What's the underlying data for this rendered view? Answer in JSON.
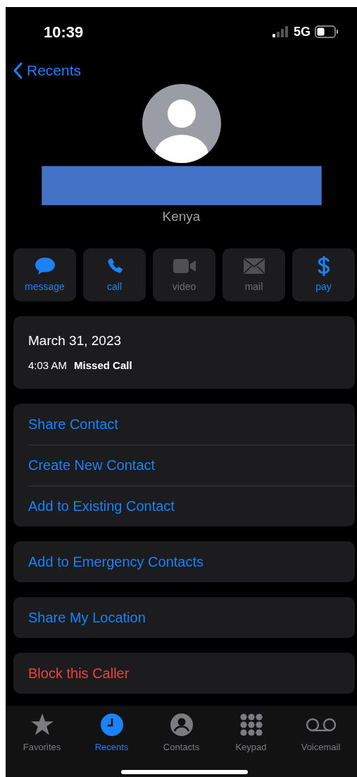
{
  "status_bar": {
    "time": "10:39",
    "network": "5G"
  },
  "nav": {
    "back_label": "Recents"
  },
  "contact": {
    "name_redacted": true,
    "location": "Kenya"
  },
  "actions": [
    {
      "kind": "message",
      "label": "message",
      "disabled": false
    },
    {
      "kind": "call",
      "label": "call",
      "disabled": false
    },
    {
      "kind": "video",
      "label": "video",
      "disabled": true
    },
    {
      "kind": "mail",
      "label": "mail",
      "disabled": true
    },
    {
      "kind": "pay",
      "label": "pay",
      "disabled": false
    }
  ],
  "call_log": {
    "date": "March 31, 2023",
    "time": "4:03 AM",
    "type": "Missed Call"
  },
  "option_groups": [
    [
      {
        "label": "Share Contact",
        "destructive": false
      },
      {
        "label": "Create New Contact",
        "destructive": false
      },
      {
        "label": "Add to Existing Contact",
        "destructive": false
      }
    ],
    [
      {
        "label": "Add to Emergency Contacts",
        "destructive": false
      }
    ],
    [
      {
        "label": "Share My Location",
        "destructive": false
      }
    ],
    [
      {
        "label": "Block this Caller",
        "destructive": true
      }
    ]
  ],
  "tab_bar": [
    {
      "kind": "favorites",
      "label": "Favorites",
      "selected": false
    },
    {
      "kind": "recents",
      "label": "Recents",
      "selected": true
    },
    {
      "kind": "contacts",
      "label": "Contacts",
      "selected": false
    },
    {
      "kind": "keypad",
      "label": "Keypad",
      "selected": false
    },
    {
      "kind": "voicemail",
      "label": "Voicemail",
      "selected": false
    }
  ]
}
